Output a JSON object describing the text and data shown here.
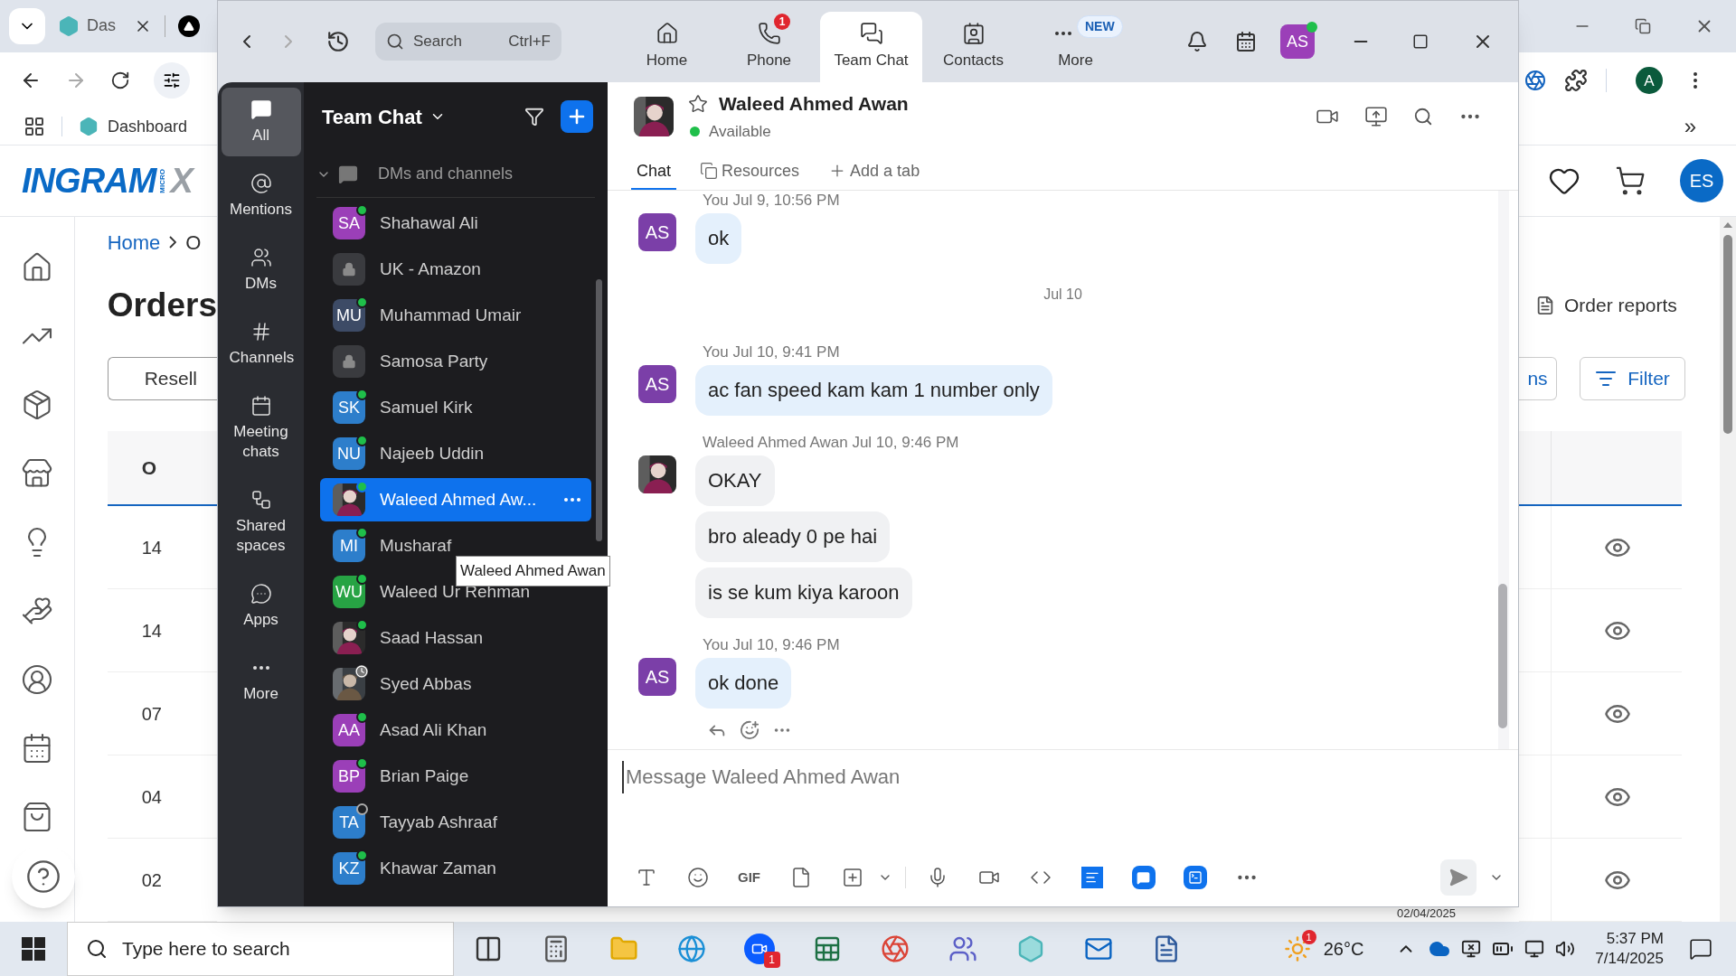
{
  "browser": {
    "tab_title": "Das",
    "bookmark": "Dashboard",
    "logo": {
      "brand": "INGRAM",
      "micro": "MICRO",
      "suffix": "X"
    },
    "breadcrumb": [
      "Home",
      "O"
    ],
    "heading": "Orders",
    "reseller_button": "Resell",
    "table": {
      "header": "O",
      "rows": [
        "14",
        "14",
        "07",
        "04",
        "02"
      ]
    },
    "order_reports": "Order reports",
    "partial_button": "ns",
    "filter_button": "Filter",
    "profile": "A",
    "overflow": "»",
    "account": "ES",
    "bottom_date": "02/04/2025"
  },
  "zoom": {
    "search": {
      "placeholder": "Search",
      "shortcut": "Ctrl+F"
    },
    "tabs": [
      {
        "label": "Home",
        "selected": false
      },
      {
        "label": "Phone",
        "selected": false,
        "badge": "1"
      },
      {
        "label": "Team Chat",
        "selected": true
      },
      {
        "label": "Contacts",
        "selected": false
      },
      {
        "label": "More",
        "selected": false,
        "badge": "NEW"
      }
    ],
    "user_avatar": "AS",
    "nav": [
      {
        "label": "All",
        "selected": true
      },
      {
        "label": "Mentions",
        "selected": false
      },
      {
        "label": "DMs",
        "selected": false
      },
      {
        "label": "Channels",
        "selected": false
      },
      {
        "label": "Meeting chats",
        "selected": false
      },
      {
        "label": "Shared spaces",
        "selected": false
      },
      {
        "label": "Apps",
        "selected": false
      },
      {
        "label": "More",
        "selected": false
      }
    ],
    "list": {
      "title": "Team Chat",
      "section": {
        "label": "DMs and channels",
        "expanded": true
      },
      "items": [
        {
          "kind": "initials",
          "initials": "SA",
          "color": "#9b3fb8",
          "name": "Shahawal Ali",
          "online": true,
          "selected": false
        },
        {
          "kind": "channel",
          "name": "UK - Amazon",
          "selected": false
        },
        {
          "kind": "initials",
          "initials": "MU",
          "color": "#3d4b66",
          "name": "Muhammad Umair",
          "online": true,
          "selected": false
        },
        {
          "kind": "channel",
          "name": "Samosa Party",
          "selected": false
        },
        {
          "kind": "initials",
          "initials": "SK",
          "color": "#2d7ecb",
          "name": "Samuel Kirk",
          "online": true,
          "selected": false
        },
        {
          "kind": "initials",
          "initials": "NU",
          "color": "#2d7ecb",
          "name": "Najeeb Uddin",
          "online": true,
          "selected": false
        },
        {
          "name": "Waleed Ahmed Aw...",
          "online": true,
          "selected": true
        },
        {
          "kind": "initials",
          "initials": "MI",
          "color": "#2d7ecb",
          "name": "Musharaf",
          "online": true,
          "selected": false
        },
        {
          "kind": "initials",
          "initials": "WU",
          "color": "#27a344",
          "name": "Waleed Ur Rehman",
          "online": true,
          "selected": false
        },
        {
          "name": "Saad Hassan",
          "online": true,
          "selected": false
        },
        {
          "name": "Syed Abbas",
          "online": false,
          "away": true,
          "selected": false
        },
        {
          "kind": "initials",
          "initials": "AA",
          "color": "#9b3fb8",
          "name": "Asad Ali Khan",
          "online": true,
          "selected": false
        },
        {
          "kind": "initials",
          "initials": "BP",
          "color": "#9b3fb8",
          "name": "Brian Paige",
          "online": true,
          "selected": false
        },
        {
          "kind": "initials",
          "initials": "TA",
          "color": "#2d7ecb",
          "name": "Tayyab Ashraaf",
          "online": false,
          "selected": false
        },
        {
          "kind": "initials",
          "initials": "KZ",
          "color": "#2d7ecb",
          "name": "Khawar Zaman",
          "online": true,
          "selected": false
        }
      ]
    },
    "tooltip": "Waleed Ahmed Awan",
    "chat": {
      "name": "Waleed Ahmed Awan",
      "status": "Available",
      "tabs": [
        {
          "label": "Chat",
          "selected": true
        },
        {
          "label": "Resources",
          "selected": false
        },
        {
          "label": "Add a tab",
          "selected": false
        }
      ],
      "messages": [
        {
          "kind": "own",
          "sender": "You",
          "time": "Jul 9, 10:56 PM",
          "avatar": "AS",
          "bubbles": [
            "ok"
          ]
        },
        {
          "kind": "date",
          "label": "Jul 10"
        },
        {
          "kind": "own",
          "sender": "You",
          "time": "Jul 10, 9:41 PM",
          "avatar": "AS",
          "bubbles": [
            "ac fan speed kam kam 1 number only"
          ]
        },
        {
          "kind": "other",
          "sender": "Waleed Ahmed Awan",
          "time": "Jul 10, 9:46 PM",
          "bubbles": [
            "OKAY",
            "bro aleady 0 pe hai",
            "is se kum kiya karoon"
          ]
        },
        {
          "kind": "own",
          "sender": "You",
          "time": "Jul 10, 9:46 PM",
          "avatar": "AS",
          "bubbles": [
            "ok done"
          ]
        }
      ],
      "composer": {
        "placeholder": "Message Waleed Ahmed Awan",
        "gif_label": "GIF"
      }
    }
  },
  "taskbar": {
    "search_placeholder": "Type here to search",
    "zoom_badge": "1",
    "weather_badge": "1",
    "temperature": "26°C",
    "time": "5:37 PM",
    "date": "7/14/2025"
  }
}
